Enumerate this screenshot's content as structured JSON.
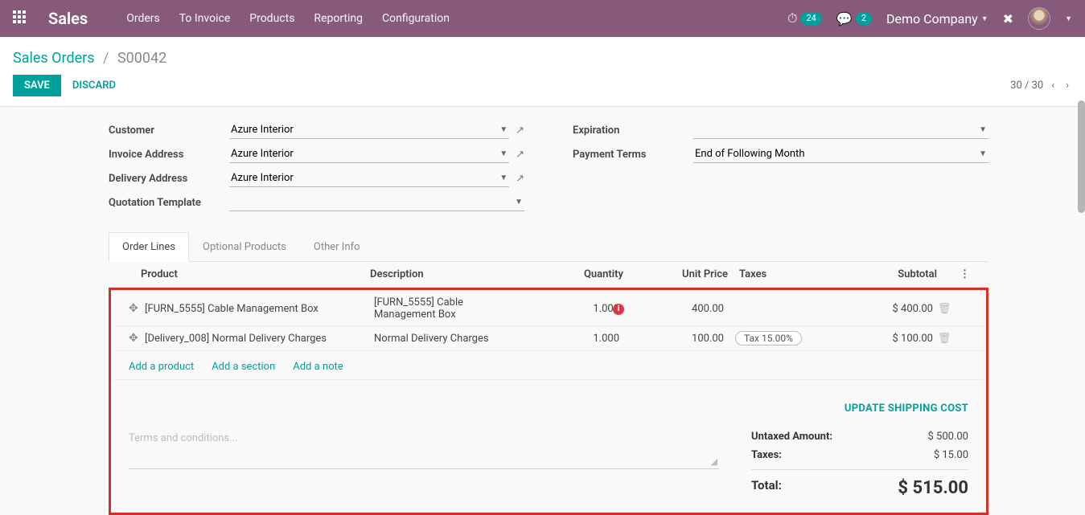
{
  "nav": {
    "brand": "Sales",
    "menu": [
      "Orders",
      "To Invoice",
      "Products",
      "Reporting",
      "Configuration"
    ],
    "activity_badge": "24",
    "chat_badge": "2",
    "company": "Demo Company"
  },
  "breadcrumb": {
    "root": "Sales Orders",
    "leaf": "S00042"
  },
  "actions": {
    "save": "SAVE",
    "discard": "DISCARD",
    "pager": "30 / 30"
  },
  "form": {
    "customer_label": "Customer",
    "customer_value": "Azure Interior",
    "invoice_label": "Invoice Address",
    "invoice_value": "Azure Interior",
    "delivery_label": "Delivery Address",
    "delivery_value": "Azure Interior",
    "template_label": "Quotation Template",
    "template_value": "",
    "expiration_label": "Expiration",
    "expiration_value": "",
    "terms_label": "Payment Terms",
    "terms_value": "End of Following Month"
  },
  "tabs": [
    "Order Lines",
    "Optional Products",
    "Other Info"
  ],
  "grid": {
    "headers": {
      "product": "Product",
      "description": "Description",
      "quantity": "Quantity",
      "unit_price": "Unit Price",
      "taxes": "Taxes",
      "subtotal": "Subtotal"
    },
    "rows": [
      {
        "product": "[FURN_5555] Cable Management Box",
        "description": "[FURN_5555] Cable Management Box",
        "qty": "1.000",
        "warn": true,
        "price": "400.00",
        "tax": "",
        "subtotal": "$ 400.00"
      },
      {
        "product": "[Delivery_008] Normal Delivery Charges",
        "description": "Normal Delivery Charges",
        "qty": "1.000",
        "warn": false,
        "price": "100.00",
        "tax": "Tax 15.00%",
        "subtotal": "$ 100.00"
      }
    ],
    "add_product": "Add a product",
    "add_section": "Add a section",
    "add_note": "Add a note",
    "update_shipping": "UPDATE SHIPPING COST",
    "terms_placeholder": "Terms and conditions...",
    "totals": {
      "untaxed_label": "Untaxed Amount:",
      "untaxed_value": "$ 500.00",
      "taxes_label": "Taxes:",
      "taxes_value": "$ 15.00",
      "total_label": "Total:",
      "total_value": "$ 515.00"
    }
  }
}
